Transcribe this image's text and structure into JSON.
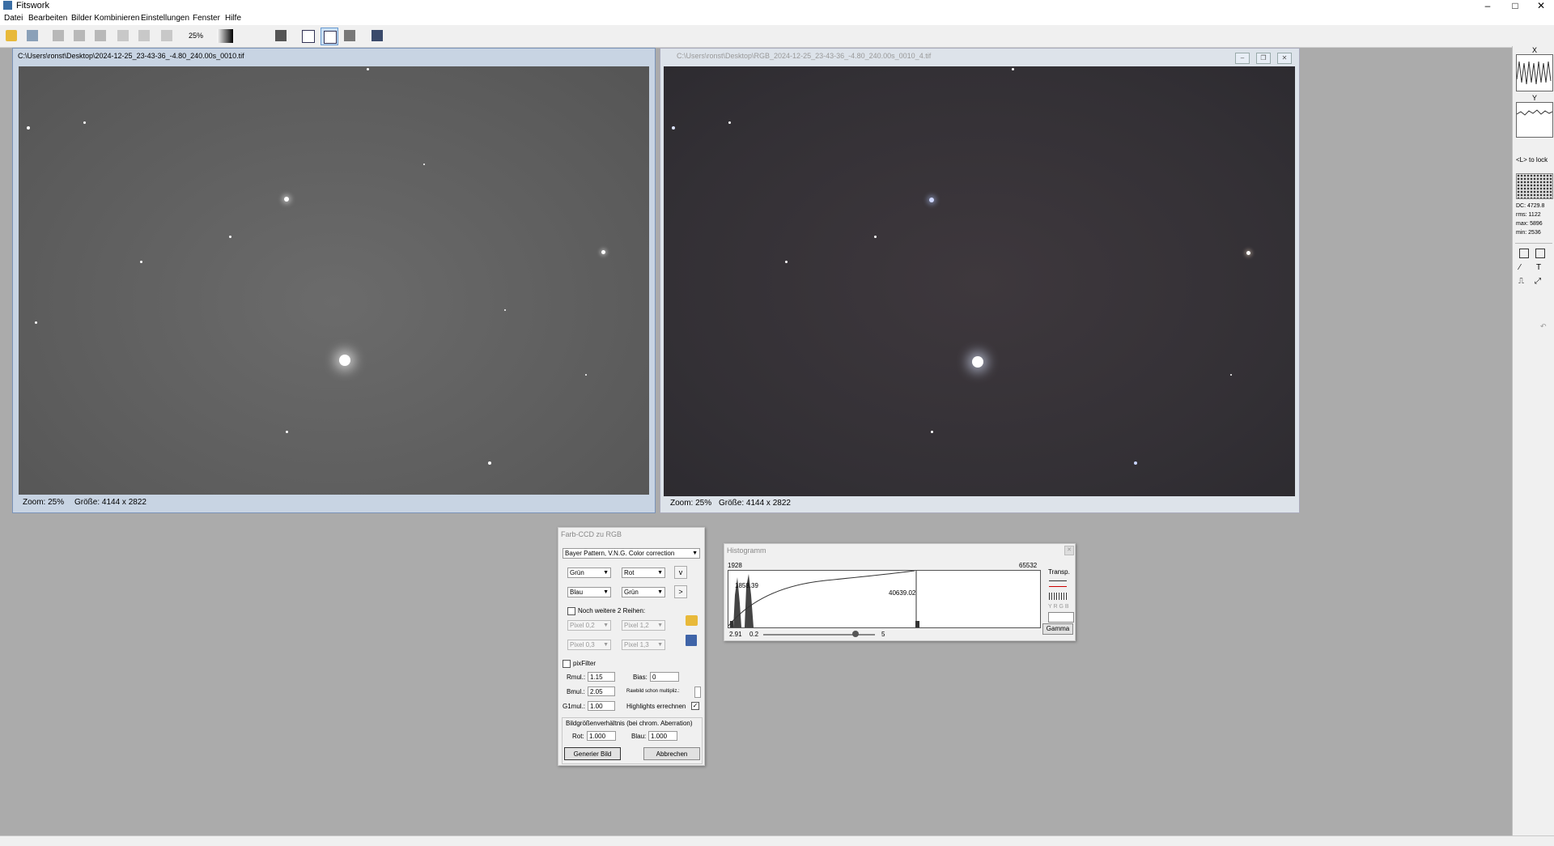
{
  "app": {
    "title": "Fitswork"
  },
  "menu": [
    "Datei",
    "Bearbeiten",
    "Bilder Kombinieren",
    "Einstellungen",
    "Fenster",
    "Hilfe"
  ],
  "toolbar": {
    "zoom_label": "25%"
  },
  "window_left": {
    "title": "C:\\Users\\ronst\\Desktop\\2024-12-25_23-43-36_-4.80_240.00s_0010.tif",
    "zoom": "Zoom: 25%",
    "size": "Größe: 4144 x 2822"
  },
  "window_right": {
    "title": "C:\\Users\\ronst\\Desktop\\RGB_2024-12-25_23-43-36_-4.80_240.00s_0010_4.tif",
    "zoom": "Zoom: 25%",
    "size": "Größe: 4144 x 2822"
  },
  "right_panel": {
    "x_label": "X",
    "y_label": "Y",
    "lock_hint": "<L> to lock",
    "stats": [
      "DC: 4729.8",
      "rms: 1122",
      "max: 5896",
      "min: 2536"
    ]
  },
  "dialog_ccd": {
    "title": "Farb-CCD zu RGB",
    "mode": "Bayer Pattern, V.N.G. Color correction",
    "pattern": [
      "Grün",
      "Rot",
      "Blau",
      "Grün"
    ],
    "more_rows_label": "Noch weitere 2 Reihen:",
    "extra_pixels": [
      "Pixel 0,2",
      "Pixel 1,2",
      "Pixel 0,3",
      "Pixel 1,3"
    ],
    "pixfilter_label": "pixFilter",
    "rmul_label": "Rmul.:",
    "rmul": "1.15",
    "bmul_label": "Bmul.:",
    "bmul": "2.05",
    "g1mul_label": "G1mul.:",
    "g1mul": "1.00",
    "bias_label": "Bias:",
    "bias": "0",
    "rawbild_label": "Rawbild schon multipliz.:",
    "highlights_label": "Highlights errechnen",
    "ratio_label": "Bildgrößenverhältnis (bei chrom. Aberration)",
    "rot_label": "Rot:",
    "rot": "1.000",
    "blau_label": "Blau:",
    "blau": "1.000",
    "btn_generate": "Generier Bild",
    "btn_cancel": "Abbrechen",
    "btn_v": "v",
    "btn_gt": ">"
  },
  "dialog_histogram": {
    "title": "Histogramm",
    "min_value": "1928",
    "max_value": "65532",
    "left_marker": "1858.39",
    "right_marker": "40639.02",
    "bottom_left": "2.91",
    "gamma_min": "0.2",
    "gamma_max": "5",
    "transp_label": "Transp.",
    "ygrb_label": "Y R G B",
    "gamma_button": "Gamma"
  }
}
